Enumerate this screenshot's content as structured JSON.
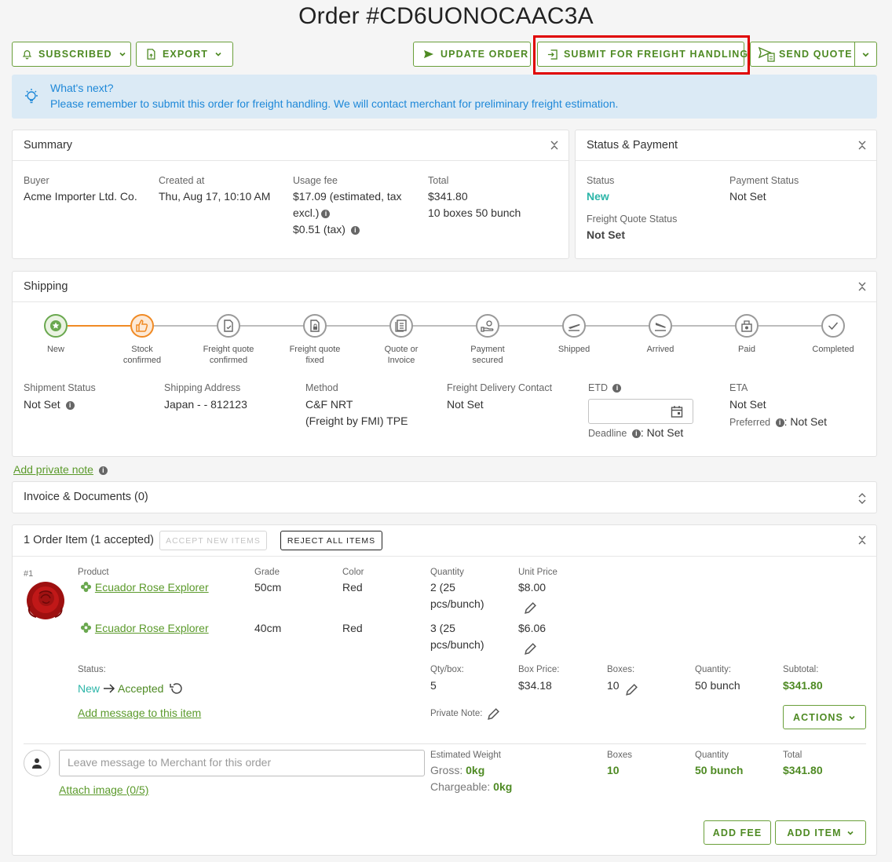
{
  "page": {
    "title": "Order #CD6UONOCAAC3A"
  },
  "toolbar": {
    "subscribed": "SUBSCRIBED",
    "export": "EXPORT",
    "update_order": "UPDATE ORDER",
    "submit_freight": "SUBMIT FOR FREIGHT HANDLING",
    "send_quote": "SEND QUOTE"
  },
  "info": {
    "title": "What's next?",
    "message": "Please remember to submit this order for freight handling. We will contact merchant for preliminary freight estimation."
  },
  "summary": {
    "header": "Summary",
    "buyer_label": "Buyer",
    "buyer": "Acme Importer Ltd. Co.",
    "created_label": "Created at",
    "created": "Thu, Aug 17, 10:10 AM",
    "usage_label": "Usage fee",
    "usage_line1": "$17.09 (estimated, tax",
    "usage_line2": "excl.)",
    "usage_tax": "$0.51 (tax)",
    "total_label": "Total",
    "total": "$341.80",
    "total_detail": "10 boxes 50 bunch"
  },
  "status_payment": {
    "header": "Status & Payment",
    "status_label": "Status",
    "status": "New",
    "payment_label": "Payment Status",
    "payment": "Not Set",
    "freight_label": "Freight Quote Status",
    "freight": "Not Set"
  },
  "shipping": {
    "header": "Shipping",
    "steps": [
      {
        "l1": "New",
        "l2": ""
      },
      {
        "l1": "Stock",
        "l2": "confirmed"
      },
      {
        "l1": "Freight quote",
        "l2": "confirmed"
      },
      {
        "l1": "Freight quote",
        "l2": "fixed"
      },
      {
        "l1": "Quote or",
        "l2": "Invoice"
      },
      {
        "l1": "Payment",
        "l2": "secured"
      },
      {
        "l1": "Shipped",
        "l2": ""
      },
      {
        "l1": "Arrived",
        "l2": ""
      },
      {
        "l1": "Paid",
        "l2": ""
      },
      {
        "l1": "Completed",
        "l2": ""
      }
    ],
    "shipment_status_label": "Shipment Status",
    "shipment_status": "Not Set",
    "address_label": "Shipping Address",
    "address": "Japan - - 812123",
    "method_label": "Method",
    "method_1": "C&F NRT",
    "method_2": "(Freight by FMI) TPE",
    "contact_label": "Freight Delivery Contact",
    "contact": "Not Set",
    "etd_label": "ETD",
    "deadline_label": "Deadline",
    "deadline": ": Not Set",
    "eta_label": "ETA",
    "eta": "Not Set",
    "preferred_label": "Preferred",
    "preferred": ": Not Set"
  },
  "private_note": "Add private note",
  "invoice": {
    "header": "Invoice & Documents (0)"
  },
  "order_items": {
    "header": "1 Order Item (1 accepted)",
    "accept_new": "ACCEPT NEW ITEMS",
    "reject_all": "REJECT ALL ITEMS",
    "index": "#1",
    "col_product": "Product",
    "col_grade": "Grade",
    "col_color": "Color",
    "col_quantity": "Quantity",
    "col_unit_price": "Unit Price",
    "rows": [
      {
        "product": "Ecuador Rose Explorer",
        "grade": "50cm",
        "color": "Red",
        "qty1": "2 (25",
        "qty2": "pcs/bunch)",
        "price": "$8.00"
      },
      {
        "product": "Ecuador Rose Explorer",
        "grade": "40cm",
        "color": "Red",
        "qty1": "3 (25",
        "qty2": "pcs/bunch)",
        "price": "$6.06"
      }
    ],
    "status_label": "Status:",
    "status_from": "New",
    "status_to": "Accepted",
    "add_message": "Add message to this item",
    "qtybox_label": "Qty/box:",
    "qtybox": "5",
    "boxprice_label": "Box Price:",
    "boxprice": "$34.18",
    "boxes_label": "Boxes:",
    "boxes": "10",
    "quantity_label": "Quantity:",
    "quantity": "50 bunch",
    "subtotal_label": "Subtotal:",
    "subtotal": "$341.80",
    "private_note_label": "Private Note:",
    "actions": "ACTIONS"
  },
  "footer": {
    "message_placeholder": "Leave message to Merchant for this order",
    "attach": "Attach image (0/5)",
    "est_weight_label": "Estimated Weight",
    "gross_label": "Gross:",
    "gross": "0kg",
    "chargeable_label": "Chargeable:",
    "chargeable": "0kg",
    "boxes_label": "Boxes",
    "boxes": "10",
    "quantity_label": "Quantity",
    "quantity": "50 bunch",
    "total_label": "Total",
    "total": "$341.80",
    "add_fee": "ADD FEE",
    "add_item": "ADD ITEM"
  },
  "colors": {
    "accent": "#4e8a23",
    "teal": "#2bb5a8",
    "info_bg": "#dbeaf5",
    "info_text": "#1e88d8",
    "highlight": "#e00000",
    "active_step": "#f08a24",
    "done_step": "#6aa84f"
  }
}
